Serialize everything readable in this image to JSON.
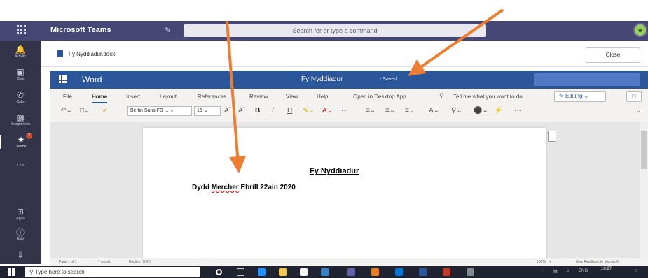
{
  "teams": {
    "app_name": "Microsoft Teams",
    "search_placeholder": "Search for or type a command",
    "compose_icon": "compose-icon"
  },
  "rail": {
    "items": [
      {
        "label": "Activity",
        "icon": "bell-icon"
      },
      {
        "label": "Chat",
        "icon": "chat-icon"
      },
      {
        "label": "Calls",
        "icon": "phone-icon"
      },
      {
        "label": "Assignments",
        "icon": "bag-icon"
      },
      {
        "label": "Teams",
        "icon": "teams-icon"
      },
      {
        "label": "",
        "icon": "more-icon"
      },
      {
        "label": "Apps",
        "icon": "apps-icon"
      },
      {
        "label": "Help",
        "icon": "help-icon"
      }
    ],
    "teams_badge": "2"
  },
  "file": {
    "name": "Fy Nyddiadur.docx",
    "close_label": "Close"
  },
  "word": {
    "app_label": "Word",
    "doc_title": "Fy Nyddiadur",
    "status": "-  Saved",
    "tabs": [
      "File",
      "Home",
      "Insert",
      "Layout",
      "References",
      "Review",
      "View",
      "Help",
      "Open in Desktop App"
    ],
    "tell_me": "Tell me what you want to do",
    "editing_label": "Editing",
    "font_name": "Berlin Sans FB ...",
    "font_size": "16"
  },
  "document": {
    "heading": "Fy Nyddiadur",
    "line_part1": "Dydd ",
    "line_part2": "Mercher",
    "line_part3": " Ebrill 22ain 2020"
  },
  "status_bar": {
    "page": "Page 1 of 1",
    "words": "7 words",
    "language": "English (U.K.)",
    "zoom": "100%",
    "feedback": "Give Feedback to Microsoft"
  },
  "taskbar": {
    "search_placeholder": "Type here to search",
    "lang": "ENG",
    "time": "16:27"
  },
  "colors": {
    "teams_purple": "#464775",
    "rail": "#33344a",
    "word_blue": "#2b579a",
    "arrow": "#ed7d31"
  }
}
